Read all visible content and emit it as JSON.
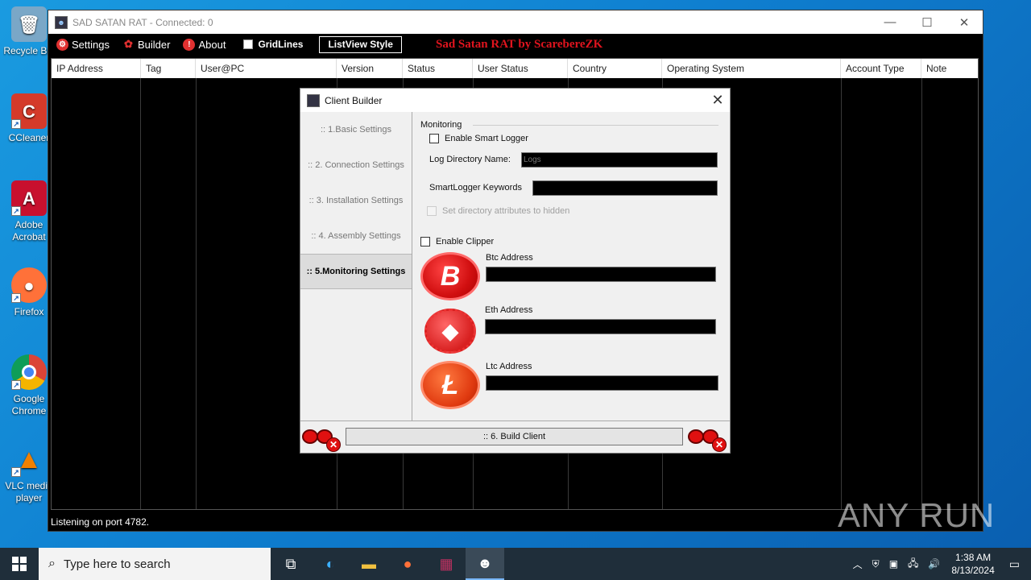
{
  "desktop": {
    "icons": [
      {
        "label": "Recycle Bin",
        "glyph": "🗑",
        "color": "#7aa7c7"
      },
      {
        "label": "CCleaner",
        "glyph": "C",
        "color": "#d43a2a"
      },
      {
        "label": "Adobe Acrobat",
        "glyph": "A",
        "color": "#c8102e"
      },
      {
        "label": "Firefox",
        "glyph": "●",
        "color": "#ff7139"
      },
      {
        "label": "Google Chrome",
        "glyph": "◉",
        "color": "#2a9d3f"
      },
      {
        "label": "VLC media player",
        "glyph": "▲",
        "color": "#f08000"
      }
    ]
  },
  "window": {
    "title": "SAD SATAN RAT - Connected: 0",
    "brand": "Sad Satan RAT by ScarebereZK",
    "menu": {
      "settings": "Settings",
      "builder": "Builder",
      "about": "About",
      "gridlines": "GridLines",
      "listview_style": "ListView Style"
    },
    "columns": [
      "IP Address",
      "Tag",
      "User@PC",
      "Version",
      "Status",
      "User Status",
      "Country",
      "Operating System",
      "Account Type",
      "Note"
    ],
    "status": "Listening on port 4782."
  },
  "dialog": {
    "title": "Client Builder",
    "sidebar": [
      ":: 1.Basic Settings",
      ":: 2. Connection Settings",
      ":: 3. Installation Settings",
      ":: 4. Assembly Settings",
      ":: 5.Monitoring Settings"
    ],
    "active_index": 4,
    "monitoring": {
      "group_title": "Monitoring",
      "enable_smart_logger": "Enable Smart Logger",
      "log_dir_label": "Log Directory Name:",
      "log_dir_placeholder": "Logs",
      "keywords_label": "SmartLogger Keywords",
      "hidden_attr_label": "Set directory attributes to hidden",
      "enable_clipper": "Enable Clipper",
      "btc_label": "Btc Address",
      "eth_label": "Eth Address",
      "ltc_label": "Ltc Address"
    },
    "build_button": ":: 6. Build Client"
  },
  "watermark": "ANY RUN",
  "taskbar": {
    "search_placeholder": "Type here to search",
    "time": "1:38 AM",
    "date": "8/13/2024"
  }
}
